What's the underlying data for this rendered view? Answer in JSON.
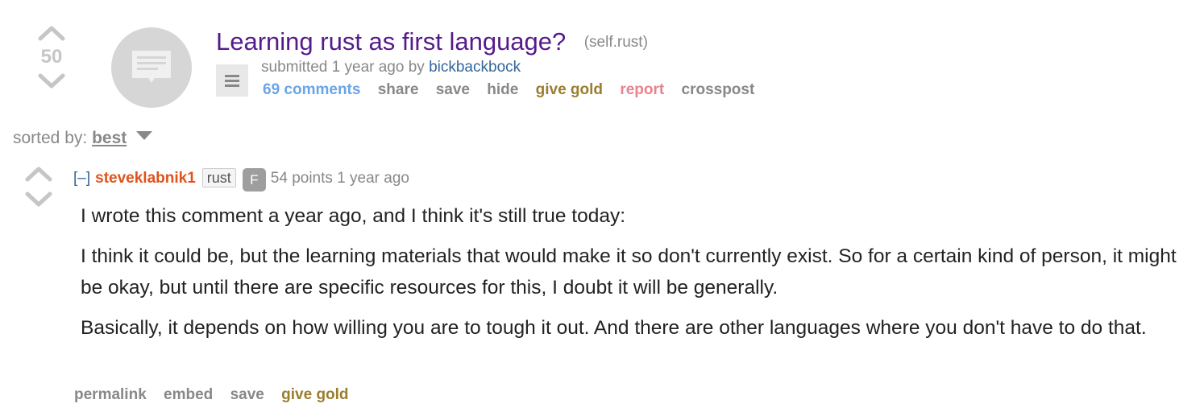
{
  "post": {
    "score": "50",
    "title": "Learning rust as first language?",
    "domain": "(self.rust)",
    "tagline_prefix": "submitted 1 year ago by ",
    "author": "bickbackbock",
    "buttons": {
      "comments": "69 comments",
      "share": "share",
      "save": "save",
      "hide": "hide",
      "give_gold": "give gold",
      "report": "report",
      "crosspost": "crosspost"
    }
  },
  "sort": {
    "label": "sorted by:",
    "value": "best"
  },
  "comment": {
    "collapse": "[–]",
    "author": "steveklabnik1",
    "flair": "rust",
    "badge": "F",
    "points_time": "54 points 1 year ago",
    "paragraphs": [
      "I wrote this comment a year ago, and I think it's still true today:",
      "I think it could be, but the learning materials that would make it so don't currently exist. So for a certain kind of person, it might be okay, but until there are specific resources for this, I doubt it will be generally.",
      "Basically, it depends on how willing you are to tough it out. And there are other languages where you don't have to do that."
    ],
    "buttons": {
      "permalink": "permalink",
      "embed": "embed",
      "save": "save",
      "give_gold": "give gold"
    }
  },
  "colors": {
    "title": "#551a8b",
    "author_link": "#336699",
    "comment_author": "#e0531a",
    "comments_link": "#6aa5e8",
    "gold": "#9a7d2f",
    "report": "#e8838e",
    "muted": "#888888"
  },
  "icons": {
    "upvote": "upvote-arrow-icon",
    "downvote": "downvote-arrow-icon",
    "thumbnail": "self-post-icon",
    "expando": "expando-text-icon",
    "sort_caret": "caret-down-icon"
  }
}
